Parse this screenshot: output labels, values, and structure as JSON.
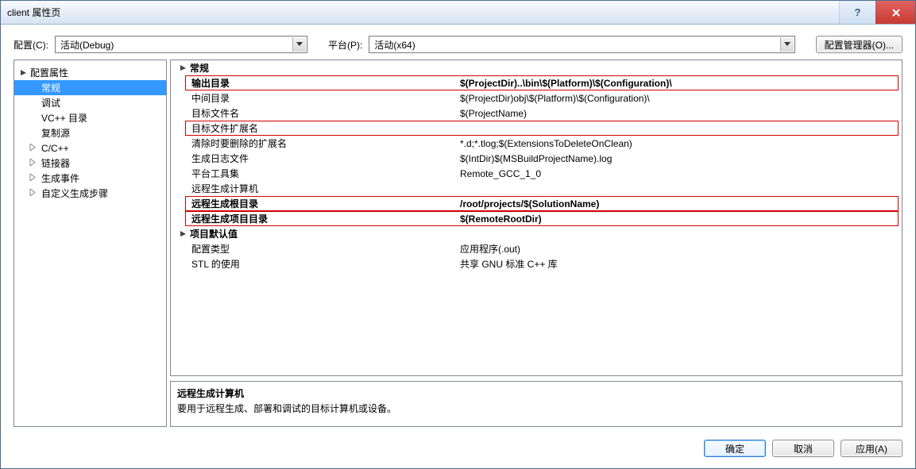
{
  "window": {
    "title": "client 属性页"
  },
  "controls": {
    "config_label": "配置(C):",
    "config_value": "活动(Debug)",
    "platform_label": "平台(P):",
    "platform_value": "活动(x64)",
    "config_mgr_btn": "配置管理器(O)..."
  },
  "tree": {
    "root": "配置属性",
    "items": [
      {
        "label": "常规",
        "selected": true
      },
      {
        "label": "调试"
      },
      {
        "label": "VC++ 目录"
      },
      {
        "label": "复制源"
      },
      {
        "label": "C/C++",
        "expandable": true
      },
      {
        "label": "链接器",
        "expandable": true
      },
      {
        "label": "生成事件",
        "expandable": true
      },
      {
        "label": "自定义生成步骤",
        "expandable": true
      }
    ]
  },
  "grid": {
    "sections": [
      {
        "title": "常规",
        "rows": [
          {
            "name": "输出目录",
            "value": "$(ProjectDir)..\\bin\\$(Platform)\\$(Configuration)\\",
            "bold": true,
            "red": true
          },
          {
            "name": "中间目录",
            "value": "$(ProjectDir)obj\\$(Platform)\\$(Configuration)\\"
          },
          {
            "name": "目标文件名",
            "value": "$(ProjectName)"
          },
          {
            "name": "目标文件扩展名",
            "value": "",
            "red": true
          },
          {
            "name": "清除时要删除的扩展名",
            "value": "*.d;*.tlog;$(ExtensionsToDeleteOnClean)"
          },
          {
            "name": "生成日志文件",
            "value": "$(IntDir)$(MSBuildProjectName).log"
          },
          {
            "name": "平台工具集",
            "value": "Remote_GCC_1_0"
          },
          {
            "name": "远程生成计算机",
            "value": ""
          },
          {
            "name": "远程生成根目录",
            "value": "/root/projects/$(SolutionName)",
            "bold": true,
            "red": true
          },
          {
            "name": "远程生成项目目录",
            "value": "$(RemoteRootDir)",
            "bold": true,
            "red": true
          }
        ]
      },
      {
        "title": "项目默认值",
        "rows": [
          {
            "name": "配置类型",
            "value": "应用程序(.out)"
          },
          {
            "name": "STL 的使用",
            "value": "共享 GNU 标准 C++ 库"
          }
        ]
      }
    ]
  },
  "hint": {
    "title": "远程生成计算机",
    "body": "要用于远程生成、部署和调试的目标计算机或设备。"
  },
  "buttons": {
    "ok": "确定",
    "cancel": "取消",
    "apply": "应用(A)"
  }
}
